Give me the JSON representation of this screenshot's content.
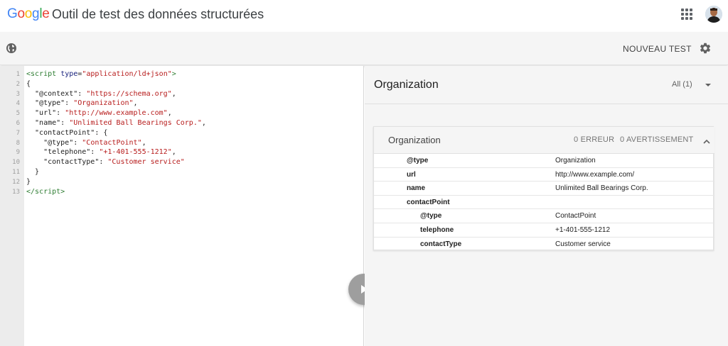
{
  "header": {
    "logo_letters": [
      {
        "ch": "G",
        "color": "#4285F4"
      },
      {
        "ch": "o",
        "color": "#EA4335"
      },
      {
        "ch": "o",
        "color": "#FBBC05"
      },
      {
        "ch": "g",
        "color": "#4285F4"
      },
      {
        "ch": "l",
        "color": "#34A853"
      },
      {
        "ch": "e",
        "color": "#EA4335"
      }
    ],
    "title": "Outil de test des données structurées",
    "apps_icon": "apps-grid-icon",
    "avatar_icon": "user-avatar"
  },
  "toolbar": {
    "globe_icon": "globe-icon",
    "new_test_label": "NOUVEAU TEST",
    "settings_icon": "gear-icon"
  },
  "editor": {
    "lines": [
      {
        "n": "1",
        "html": "<span class=\"tag\">&lt;script</span> <span class=\"attr\">type</span>=<span class=\"str\">\"application/ld+json\"</span><span class=\"tag\">&gt;</span>"
      },
      {
        "n": "2",
        "html": "{"
      },
      {
        "n": "3",
        "html": "  \"@context\": <span class=\"str\">\"https://schema.org\"</span>,"
      },
      {
        "n": "4",
        "html": "  \"@type\": <span class=\"str\">\"Organization\"</span>,"
      },
      {
        "n": "5",
        "html": "  \"url\": <span class=\"str\">\"http://www.example.com\"</span>,"
      },
      {
        "n": "6",
        "html": "  \"name\": <span class=\"str\">\"Unlimited Ball Bearings Corp.\"</span>,"
      },
      {
        "n": "7",
        "html": "  \"contactPoint\": {"
      },
      {
        "n": "8",
        "html": "    \"@type\": <span class=\"str\">\"ContactPoint\"</span>,"
      },
      {
        "n": "9",
        "html": "    \"telephone\": <span class=\"str\">\"+1-401-555-1212\"</span>,"
      },
      {
        "n": "10",
        "html": "    \"contactType\": <span class=\"str\">\"Customer service\"</span>"
      },
      {
        "n": "11",
        "html": "  }"
      },
      {
        "n": "12",
        "html": "}"
      },
      {
        "n": "13",
        "html": "<span class=\"tag\">&lt;/script&gt;</span>"
      }
    ],
    "run_icon": "play-icon"
  },
  "results": {
    "title": "Organization",
    "filter_value": "All (1)",
    "card": {
      "title": "Organization",
      "errors": "0 ERREUR",
      "warnings": "0 AVERTISSEMENT",
      "properties": [
        {
          "key": "@type",
          "value": "Organization",
          "indent": 0
        },
        {
          "key": "url",
          "value": "http://www.example.com/",
          "indent": 0
        },
        {
          "key": "name",
          "value": "Unlimited Ball Bearings Corp.",
          "indent": 0
        },
        {
          "key": "contactPoint",
          "value": "",
          "indent": 0
        },
        {
          "key": "@type",
          "value": "ContactPoint",
          "indent": 1
        },
        {
          "key": "telephone",
          "value": "+1-401-555-1212",
          "indent": 1
        },
        {
          "key": "contactType",
          "value": "Customer service",
          "indent": 1
        }
      ]
    }
  }
}
